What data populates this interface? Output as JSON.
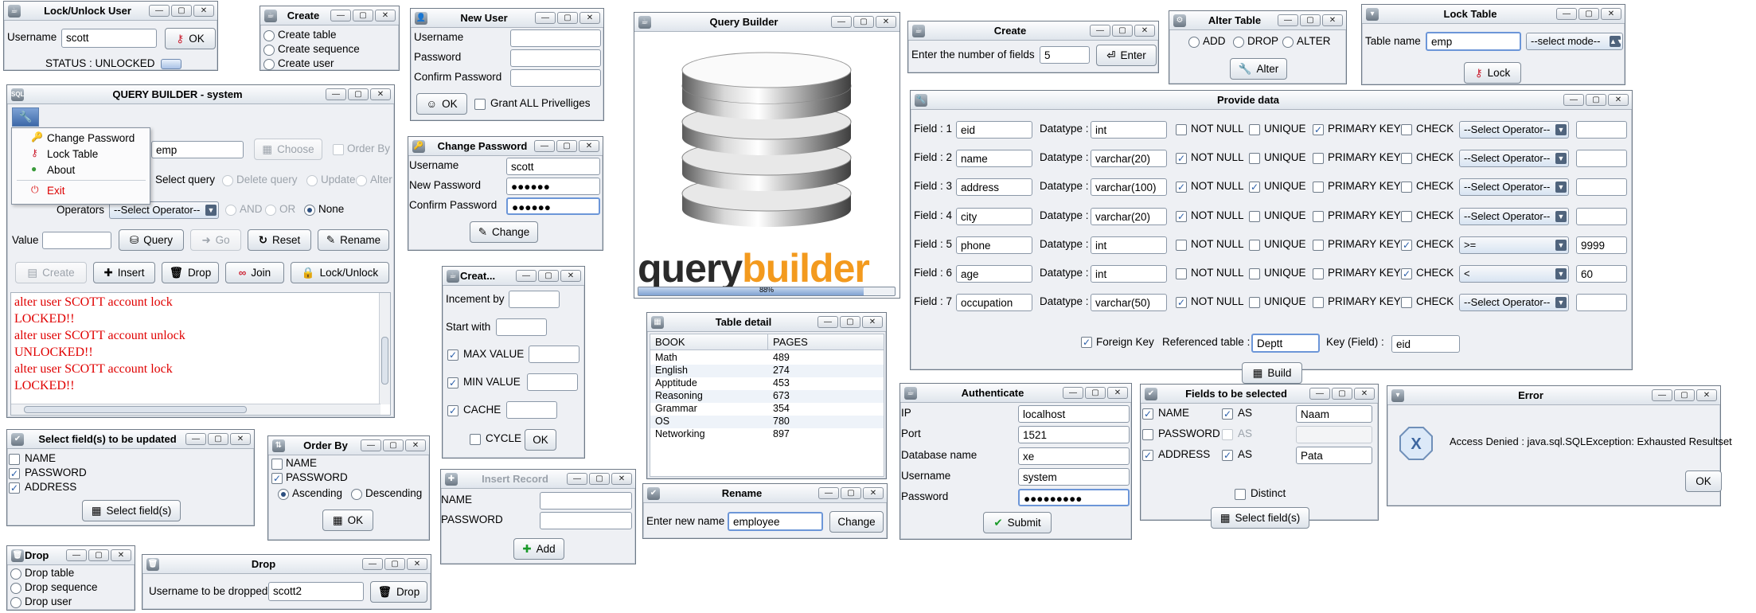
{
  "lock_unlock_user": {
    "title": "Lock/Unlock User",
    "username_label": "Username",
    "username_value": "scott",
    "ok": "OK",
    "status": "STATUS : UNLOCKED"
  },
  "create_menu": {
    "title": "Create",
    "items": [
      "Create table",
      "Create sequence",
      "Create user"
    ]
  },
  "new_user": {
    "title": "New User",
    "username_label": "Username",
    "password_label": "Password",
    "confirm_label": "Confirm Password",
    "ok": "OK",
    "grant_all": "Grant ALL Privelliges"
  },
  "change_password": {
    "title": "Change Password",
    "username_label": "Username",
    "username_value": "scott",
    "new_label": "New Password",
    "new_value": "●●●●●●",
    "confirm_label": "Confirm Password",
    "confirm_value": "●●●●●●",
    "change": "Change"
  },
  "qb_main": {
    "title": "QUERY BUILDER - system",
    "menu": [
      "Change Password",
      "Lock Table",
      "About",
      "Exit"
    ],
    "table_value": "emp",
    "choose": "Choose",
    "order_by": "Order By",
    "select_query": "Select query",
    "delete_query": "Delete query",
    "update": "Update",
    "alter": "Alter",
    "operators_label": "Operators",
    "operator_select": "--Select Operator--",
    "and": "AND",
    "or": "OR",
    "none": "None",
    "value_label": "Value",
    "query": "Query",
    "go": "Go",
    "reset": "Reset",
    "rename": "Rename",
    "create": "Create",
    "insert": "Insert",
    "drop": "Drop",
    "join": "Join",
    "lock_unlock": "Lock/Unlock",
    "log": [
      "alter user SCOTT account lock",
      "LOCKED!!",
      "alter user SCOTT account unlock",
      "UNLOCKED!!",
      "alter user SCOTT account lock",
      "LOCKED!!"
    ]
  },
  "splash": {
    "title": "Query Builder",
    "logo_query": "query",
    "logo_builder": "builder",
    "progress": "88%",
    "progress_value": 0.88
  },
  "create_fields": {
    "title": "Create",
    "label": "Enter the number of fields",
    "value": "5",
    "enter": "Enter"
  },
  "alter_table": {
    "title": "Alter Table",
    "add": "ADD",
    "drop": "DROP",
    "alter": "ALTER",
    "button": "Alter"
  },
  "lock_table": {
    "title": "Lock Table",
    "name_label": "Table name",
    "name_value": "emp",
    "mode": "--select mode--",
    "lock": "Lock"
  },
  "provide_data": {
    "title": "Provide data",
    "field_labels": [
      "Field : 1",
      "Field : 2",
      "Field : 3",
      "Field : 4",
      "Field : 5",
      "Field : 6",
      "Field : 7"
    ],
    "field_values": [
      "eid",
      "name",
      "address",
      "city",
      "phone",
      "age",
      "occupation"
    ],
    "datatype_label": "Datatype :",
    "datatypes": [
      "int",
      "varchar(20)",
      "varchar(100)",
      "varchar(20)",
      "int",
      "int",
      "varchar(50)"
    ],
    "notnull": "NOT NULL",
    "unique": "UNIQUE",
    "pk": "PRIMARY KEY",
    "check": "CHECK",
    "operators": [
      "--Select Operator--",
      "--Select Operator--",
      "--Select Operator--",
      "--Select Operator--",
      ">=",
      "<",
      "--Select Operator--"
    ],
    "check_values": [
      "",
      "",
      "",
      "",
      "9999",
      "60",
      ""
    ],
    "notnull_checked": [
      false,
      true,
      true,
      true,
      false,
      false,
      true
    ],
    "unique_checked": [
      false,
      false,
      true,
      false,
      false,
      false,
      false
    ],
    "pk_checked": [
      true,
      false,
      false,
      false,
      false,
      false,
      false
    ],
    "check_checked": [
      false,
      false,
      false,
      false,
      true,
      true,
      false
    ],
    "fk_label": "Foreign Key",
    "ref_label": "Referenced table :",
    "ref_value": "Deptt",
    "key_label": "Key (Field) :",
    "key_value": "eid",
    "build": "Build"
  },
  "select_fields_update": {
    "title": "Select field(s) to be updated",
    "items": [
      "NAME",
      "PASSWORD",
      "ADDRESS"
    ],
    "checked": [
      false,
      true,
      true
    ],
    "button": "Select field(s)"
  },
  "order_by": {
    "title": "Order By",
    "items": [
      "NAME",
      "PASSWORD"
    ],
    "checked": [
      false,
      true
    ],
    "asc": "Ascending",
    "desc": "Descending",
    "ok": "OK"
  },
  "create_sequence": {
    "title": "Creat...",
    "inc": "Incement by",
    "start": "Start with",
    "max": "MAX VALUE",
    "min": "MIN VALUE",
    "cache": "CACHE",
    "cycle": "CYCLE",
    "ok": "OK"
  },
  "table_detail": {
    "title": "Table detail",
    "columns": [
      "BOOK",
      "PAGES"
    ],
    "rows": [
      [
        "Math",
        "489"
      ],
      [
        "English",
        "274"
      ],
      [
        "Apptitude",
        "453"
      ],
      [
        "Reasoning",
        "673"
      ],
      [
        "Grammar",
        "354"
      ],
      [
        "OS",
        "780"
      ],
      [
        "Networking",
        "897"
      ]
    ]
  },
  "authenticate": {
    "title": "Authenticate",
    "labels": [
      "IP",
      "Port",
      "Database name",
      "Username",
      "Password"
    ],
    "values": [
      "localhost",
      "1521",
      "xe",
      "system",
      "●●●●●●●●●"
    ],
    "submit": "Submit"
  },
  "fields_selected": {
    "title": "Fields to be selected",
    "items": [
      "NAME",
      "PASSWORD",
      "ADDRESS"
    ],
    "checked": [
      true,
      false,
      true
    ],
    "as": "AS",
    "as_checked": [
      true,
      false,
      true
    ],
    "aliases": [
      "Naam",
      "",
      "Pata"
    ],
    "distinct": "Distinct",
    "button": "Select field(s)"
  },
  "error": {
    "title": "Error",
    "message": "Access Denied : java.sql.SQLException: Exhausted Resultset",
    "ok": "OK"
  },
  "insert_record": {
    "title": "Insert Record",
    "name": "NAME",
    "password": "PASSWORD",
    "add": "Add"
  },
  "rename": {
    "title": "Rename",
    "label": "Enter new name",
    "value": "employee",
    "change": "Change"
  },
  "drop_menu": {
    "title": "Drop",
    "items": [
      "Drop table",
      "Drop sequence",
      "Drop user"
    ]
  },
  "drop_user": {
    "title": "Drop",
    "label": "Username to be dropped",
    "value": "scott2",
    "drop": "Drop"
  },
  "colors": {
    "accent": "#f39a1e",
    "log_text": "#e00000",
    "logo_dark": "#2a2a2a"
  }
}
